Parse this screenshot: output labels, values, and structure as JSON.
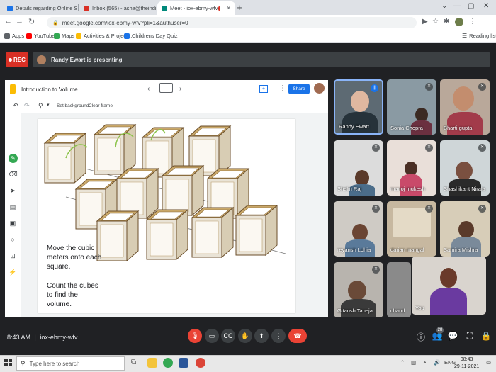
{
  "browser": {
    "tabs": [
      {
        "title": "Details regarding Online Session",
        "favicon_color": "#1a73e8"
      },
      {
        "title": "Inbox (565) - asha@theindiansch",
        "favicon_color": "#d93025"
      },
      {
        "title": "Meet - iox-ebmy-wfv",
        "favicon_color": "#00897b"
      }
    ],
    "new_tab_label": "+",
    "url": "meet.google.com/iox-ebmy-wfv?pli=1&authuser=0",
    "bookmarks": [
      {
        "label": "Apps",
        "color": "#5f6368"
      },
      {
        "label": "YouTube",
        "color": "#ff0000"
      },
      {
        "label": "Maps",
        "color": "#34a853"
      },
      {
        "label": "Activities & Project...",
        "color": "#fbbc04"
      },
      {
        "label": "Childrens Day Quiz",
        "color": "#1a73e8"
      }
    ],
    "reading_list_label": "Reading list"
  },
  "meet": {
    "rec_label": "REC",
    "presenting_text": "Randy Ewart is presenting",
    "slide": {
      "title": "Introduction to Volume",
      "share_label": "Share",
      "set_background_label": "Set background",
      "clear_frame_label": "Clear frame",
      "instruction_1": "Move the cubic meters onto each square.",
      "instruction_2": "Count the cubes to find the volume."
    },
    "participants": [
      {
        "name": "Randy Ewart",
        "mic": "speaking"
      },
      {
        "name": "Sonia Chopra",
        "mic": "muted"
      },
      {
        "name": "Bharti gupta",
        "mic": "muted"
      },
      {
        "name": "Shelin Raj",
        "mic": "muted"
      },
      {
        "name": "manoj mukesh",
        "mic": "muted"
      },
      {
        "name": "Shashikant Nirala",
        "mic": "muted"
      },
      {
        "name": "reyansh Lohia",
        "mic": "muted"
      },
      {
        "name": "darian mangal",
        "mic": "muted"
      },
      {
        "name": "Samira Mishra",
        "mic": "muted"
      },
      {
        "name": "Gitansh Taneja",
        "mic": "muted"
      },
      {
        "name": "chand",
        "mic": "none"
      },
      {
        "name": "You",
        "mic": "none"
      }
    ],
    "time": "8:43 AM",
    "meeting_code": "iox-ebmy-wfv",
    "participant_count": "28"
  },
  "taskbar": {
    "search_placeholder": "Type here to search",
    "language": "ENG",
    "time": "08:43",
    "date": "29-11-2021"
  }
}
